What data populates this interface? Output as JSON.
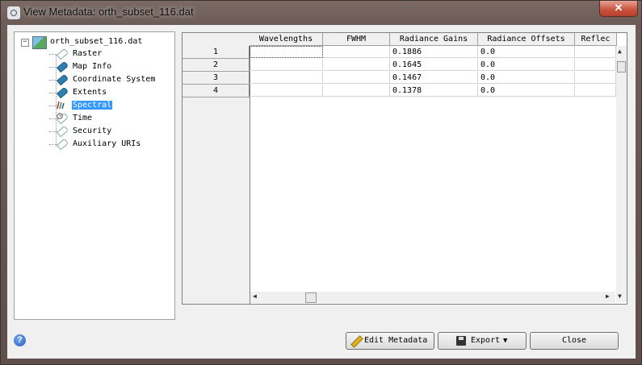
{
  "window": {
    "title": "View Metadata: orth_subset_116.dat",
    "close_glyph": "✕"
  },
  "tree": {
    "root": {
      "label": "orth_subset_116.dat",
      "expander": "−",
      "icon": "raster-file-icon"
    },
    "items": [
      {
        "label": "Raster",
        "icon": "tag-outline-icon",
        "selected": false
      },
      {
        "label": "Map Info",
        "icon": "tag-filled-icon",
        "selected": false
      },
      {
        "label": "Coordinate System",
        "icon": "tag-filled-icon",
        "selected": false
      },
      {
        "label": "Extents",
        "icon": "tag-filled-icon",
        "selected": false
      },
      {
        "label": "Spectral",
        "icon": "spectral-icon",
        "selected": true
      },
      {
        "label": "Time",
        "icon": "clock-tag-icon",
        "selected": false
      },
      {
        "label": "Security",
        "icon": "tag-outline-icon",
        "selected": false
      },
      {
        "label": "Auxiliary URIs",
        "icon": "tag-outline-icon",
        "selected": false
      }
    ]
  },
  "grid": {
    "columns": [
      "Wavelengths",
      "FWHM",
      "Radiance Gains",
      "Radiance Offsets",
      "Reflec"
    ],
    "rows": [
      {
        "header": "1",
        "cells": [
          "",
          "",
          "0.1886",
          "0.0",
          ""
        ]
      },
      {
        "header": "2",
        "cells": [
          "",
          "",
          "0.1645",
          "0.0",
          ""
        ]
      },
      {
        "header": "3",
        "cells": [
          "",
          "",
          "0.1467",
          "0.0",
          ""
        ]
      },
      {
        "header": "4",
        "cells": [
          "",
          "",
          "0.1378",
          "0.0",
          ""
        ]
      }
    ]
  },
  "buttons": {
    "edit_metadata": "Edit Metadata",
    "export": "Export",
    "export_arrow": "▼",
    "close": "Close",
    "help": "?"
  },
  "colors": {
    "selection": "#3399ff",
    "titlebar": "#6d5c57",
    "close_button": "#c8513b"
  }
}
